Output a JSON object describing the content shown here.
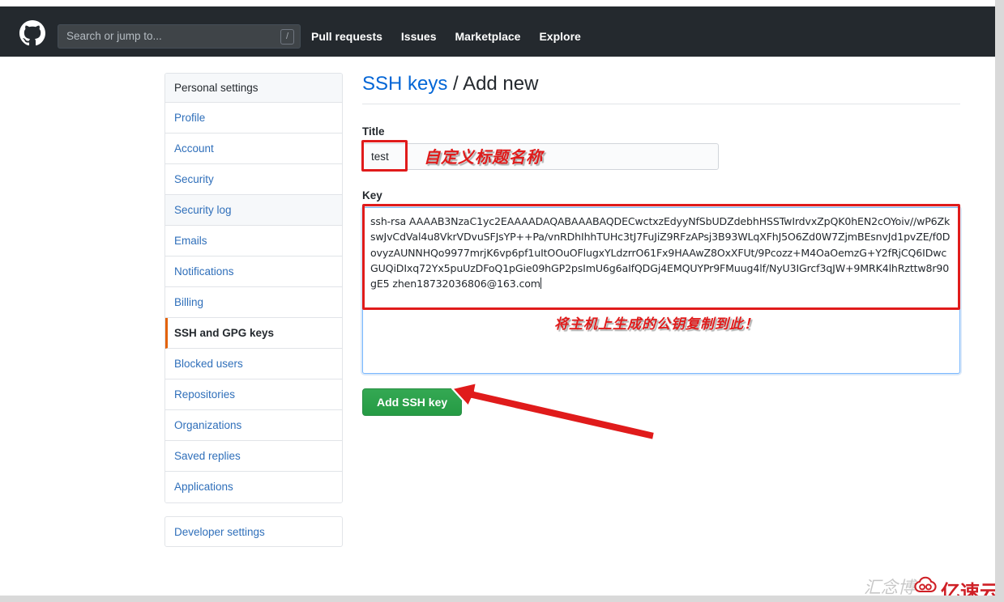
{
  "header": {
    "logo_icon": "github-mark-icon",
    "search": {
      "placeholder": "Search or jump to...",
      "value": "",
      "shortcut_badge": "/"
    },
    "nav": [
      {
        "label": "Pull requests"
      },
      {
        "label": "Issues"
      },
      {
        "label": "Marketplace"
      },
      {
        "label": "Explore"
      }
    ],
    "background_color": "#24292e"
  },
  "sidebar": {
    "heading": "Personal settings",
    "items": [
      {
        "label": "Profile",
        "selected": false
      },
      {
        "label": "Account",
        "selected": false
      },
      {
        "label": "Security",
        "selected": false
      },
      {
        "label": "Security log",
        "selected": false
      },
      {
        "label": "Emails",
        "selected": false
      },
      {
        "label": "Notifications",
        "selected": false
      },
      {
        "label": "Billing",
        "selected": false
      },
      {
        "label": "SSH and GPG keys",
        "selected": true
      },
      {
        "label": "Blocked users",
        "selected": false
      },
      {
        "label": "Repositories",
        "selected": false
      },
      {
        "label": "Organizations",
        "selected": false
      },
      {
        "label": "Saved replies",
        "selected": false
      },
      {
        "label": "Applications",
        "selected": false
      }
    ],
    "developer_settings": "Developer settings",
    "selected_accent_color": "#e36209"
  },
  "main": {
    "title_link": "SSH keys",
    "title_separator": "/",
    "title_current": "Add new",
    "title_field": {
      "label": "Title",
      "value": "test",
      "placeholder": ""
    },
    "key_field": {
      "label": "Key",
      "value": "ssh-rsa AAAAB3NzaC1yc2EAAAADAQABAAABAQDECwctxzEdyyNfSbUDZdebhHSSTwIrdvxZpQK0hEN2cOYoiv//wP6ZkswJvCdVal4u8VkrVDvuSFJsYP++Pa/vnRDhIhhTUHc3tJ7FuJiZ9RFzAPsj3B93WLqXFhJ5O6Zd0W7ZjmBEsnvJd1pvZE/f0DovyzAUNNHQo9977mrjK6vp6pf1uItOOuOFlugxYLdzrrO61Fx9HAAwZ8OxXFUt/9Pcozz+M4OaOemzG+Y2fRjCQ6IDwcGUQiDIxq72Yx5puUzDFoQ1pGie09hGP2psImU6g6aIfQDGj4EMQUYPr9FMuug4lf/NyU3IGrcf3qJW+9MRK4lhRzttw8r90gE5 zhen18732036806@163.com"
    },
    "submit_button": "Add SSH key"
  },
  "annotations": {
    "title_note": "自定义标题名称",
    "key_note": "将主机上生成的公钥复制到此！",
    "box_color": "#e01b1b",
    "arrow_color": "#e01b1b",
    "arrow_target": "Add SSH key"
  },
  "watermark": {
    "ghost_text": "汇念博",
    "brand": "亿速云",
    "brand_color": "#cf2026",
    "logo_icon": "yisuyun-cloud-icon"
  }
}
